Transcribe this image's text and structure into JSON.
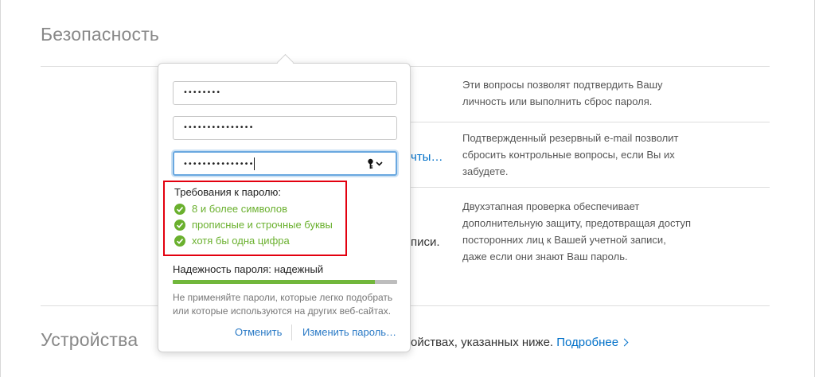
{
  "sections": {
    "security_title": "Безопасность",
    "devices_title": "Устройства"
  },
  "descriptions": {
    "questions": "Эти вопросы позволят подтвердить Вашу личность или выполнить сброс пароля.",
    "rescue_email": "Подтвержденный резервный e-mail позволит сбросить контрольные вопросы, если Вы их забудете.",
    "two_step": "Двухэтапная проверка обеспечивает дополнительную защиту, предотвращая доступ посторонних лиц к Вашей учетной записи, даже если они знают Ваш пароль."
  },
  "background": {
    "partial_link_email": "чты…",
    "partial_text_account": "писи.",
    "devices_text": "ойствах, указанных ниже.",
    "devices_link": "Подробнее"
  },
  "popover": {
    "current_password": "••••••••",
    "new_password": "•••••••••••••••",
    "confirm_password": "•••••••••••••••",
    "requirements_title": "Требования к паролю:",
    "requirements": [
      "8 и более символов",
      "прописные и строчные буквы",
      "хотя бы одна цифра"
    ],
    "strength_label": "Надежность пароля: надежный",
    "strength_fraction": 0.9,
    "hint": "Не применяйте пароли, которые легко подобрать или которые используются на других веб-сайтах.",
    "cancel_label": "Отменить",
    "change_label": "Изменить пароль…"
  },
  "colors": {
    "accent": "#2a7ac6",
    "success": "#6ab02e",
    "highlight": "#e3000f"
  },
  "icons": {
    "key": "key-icon",
    "chevron": "chevron-down-icon",
    "check": "check-circle-icon",
    "link_arrow": "chevron-right-icon"
  }
}
